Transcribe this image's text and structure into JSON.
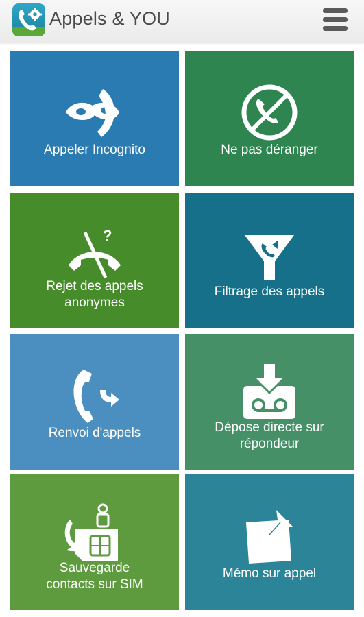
{
  "header": {
    "title": "Appels & YOU",
    "icon": "app-phone-gear-icon",
    "menu_icon": "hamburger-menu-icon"
  },
  "tiles": [
    {
      "line1": "Appeler Incognito",
      "line2": "",
      "icon": "incognito-mask-phone-icon",
      "color": "#2b7bb3"
    },
    {
      "line1": "Ne pas déranger",
      "line2": "",
      "icon": "do-not-disturb-phone-icon",
      "color": "#2e8550"
    },
    {
      "line1": "Rejet des appels",
      "line2": "anonymes",
      "icon": "reject-anonymous-call-icon",
      "color": "#468c2a"
    },
    {
      "line1": "Filtrage des appels",
      "line2": "",
      "icon": "call-filter-funnel-icon",
      "color": "#16708a"
    },
    {
      "line1": "Renvoi d'appels",
      "line2": "",
      "icon": "call-forward-icon",
      "color": "#4a8fc0"
    },
    {
      "line1": "Dépose directe sur",
      "line2": "répondeur",
      "icon": "voicemail-drop-icon",
      "color": "#469068"
    },
    {
      "line1": "Sauvegarde",
      "line2": "contacts sur SIM",
      "icon": "sim-contacts-backup-icon",
      "color": "#5e9b3f"
    },
    {
      "line1": "Mémo sur appel",
      "line2": "",
      "icon": "call-memo-note-icon",
      "color": "#2c8499"
    }
  ]
}
